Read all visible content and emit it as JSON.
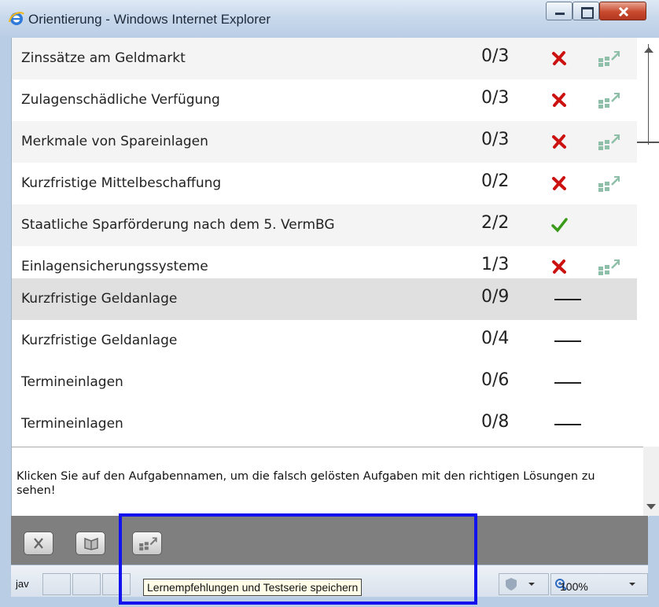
{
  "window": {
    "title": "Orientierung - Windows Internet Explorer"
  },
  "rows": [
    {
      "name": "Zinssätze am Geldmarkt",
      "score": "0/3",
      "status": "wrong",
      "recommendation": true
    },
    {
      "name": "Zulagenschädliche Verfügung",
      "score": "0/3",
      "status": "wrong",
      "recommendation": true
    },
    {
      "name": "Merkmale von Spareinlagen",
      "score": "0/3",
      "status": "wrong",
      "recommendation": true
    },
    {
      "name": "Kurzfristige Mittelbeschaffung",
      "score": "0/2",
      "status": "wrong",
      "recommendation": true
    },
    {
      "name": "Staatliche Sparförderung nach dem 5. VermBG",
      "score": "2/2",
      "status": "correct",
      "recommendation": false
    },
    {
      "name": "Einlagensicherungssysteme",
      "score": "1/3",
      "status": "wrong",
      "recommendation": true
    },
    {
      "name": "Kurzfristige Geldanlage",
      "score": "0/9",
      "status": "dash",
      "recommendation": false
    },
    {
      "name": "Kurzfristige Geldanlage",
      "score": "0/4",
      "status": "dash",
      "recommendation": false
    },
    {
      "name": "Termineinlagen",
      "score": "0/6",
      "status": "dash",
      "recommendation": false
    },
    {
      "name": "Termineinlagen",
      "score": "0/8",
      "status": "dash",
      "recommendation": false
    }
  ],
  "info": {
    "text": "Klicken Sie auf den Aufgabennamen, um die falsch gelösten Aufgaben mit den richtigen Lösungen zu sehen!"
  },
  "toolbar": {
    "buttons": [
      "close-icon",
      "book-icon",
      "recommendation-icon"
    ]
  },
  "statusbar": {
    "text": "jav",
    "tooltip": "Lernempfehlungen und Testserie speichern",
    "zoom": "100%"
  },
  "colors": {
    "wrong": "#cc1111",
    "correct": "#3a9a1a",
    "highlight": "#1212ee"
  }
}
